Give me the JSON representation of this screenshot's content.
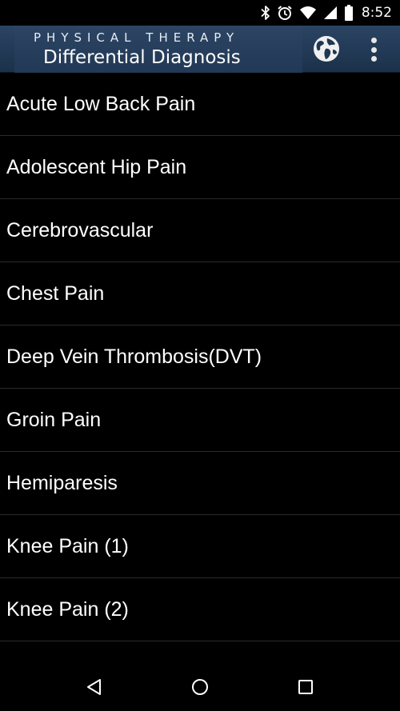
{
  "status_bar": {
    "time": "8:52",
    "icons": [
      "bluetooth-icon",
      "alarm-icon",
      "wifi-icon",
      "signal-icon",
      "battery-icon"
    ]
  },
  "app_bar": {
    "subtitle": "PHYSICAL THERAPY",
    "title": "Differential Diagnosis",
    "background_color": "#223a56",
    "actions": [
      "globe-icon",
      "overflow-menu-icon"
    ]
  },
  "list": {
    "items": [
      "Acute Low Back Pain",
      "Adolescent Hip Pain",
      "Cerebrovascular",
      "Chest Pain",
      "Deep Vein Thrombosis(DVT)",
      "Groin Pain",
      "Hemiparesis",
      "Knee Pain (1)",
      "Knee Pain (2)"
    ]
  },
  "nav_bar": {
    "buttons": [
      "back-icon",
      "home-icon",
      "recents-icon"
    ]
  }
}
